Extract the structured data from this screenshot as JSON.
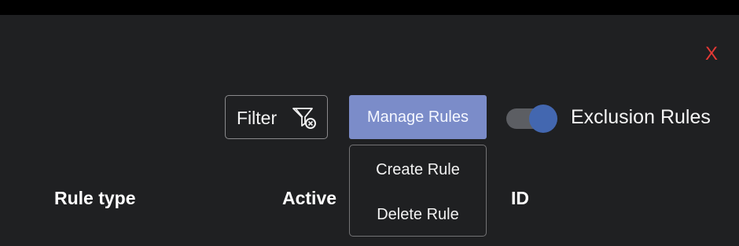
{
  "header": {
    "close_label": "X"
  },
  "toolbar": {
    "filter_label": "Filter",
    "filter_icon": "filter-remove-icon",
    "manage_rules_label": "Manage Rules",
    "exclusion_toggle": {
      "label": "Exclusion Rules",
      "state": "on"
    }
  },
  "manage_rules_menu": {
    "items": [
      {
        "label": "Create Rule"
      },
      {
        "label": "Delete Rule"
      }
    ]
  },
  "table": {
    "columns": [
      "Rule type",
      "Active",
      "ID"
    ]
  },
  "colors": {
    "background": "#1f2022",
    "top_bar": "#000000",
    "accent": "#7b8cc9",
    "toggle_knob": "#4367b0",
    "close": "#e53935"
  }
}
